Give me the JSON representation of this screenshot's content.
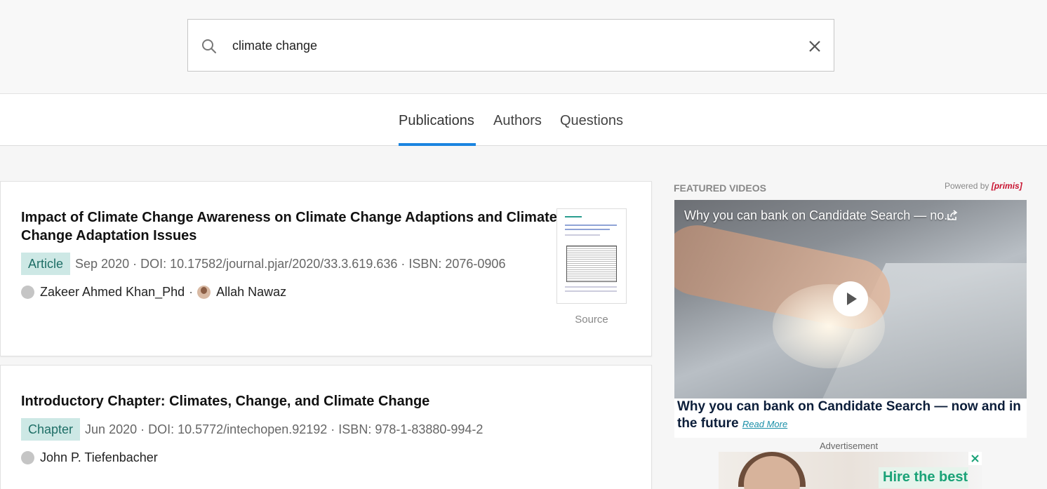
{
  "search": {
    "value": "climate change"
  },
  "tabs": [
    {
      "label": "Publications",
      "active": true
    },
    {
      "label": "Authors",
      "active": false
    },
    {
      "label": "Questions",
      "active": false
    }
  ],
  "results": [
    {
      "title_line1": "Impact of Climate Change Awareness on Climate Change Adaptions and Climate",
      "title_line2": "Change Adaptation Issues",
      "type": "Article",
      "meta": "Sep 2020 · DOI: 10.17582/journal.pjar/2020/33.3.619.636 · ISBN: 2076-0906",
      "authors": [
        "Zakeer Ahmed Khan_Phd",
        "Allah Nawaz"
      ],
      "source_label": "Source"
    },
    {
      "title_line1": "Introductory Chapter: Climates, Change, and Climate Change",
      "type": "Chapter",
      "meta": "Jun 2020 · DOI: 10.5772/intechopen.92192 · ISBN: 978-1-83880-994-2",
      "authors": [
        "John P. Tiefenbacher"
      ]
    }
  ],
  "sidebar": {
    "featured_label": "FEATURED VIDEOS",
    "powered_by": "Powered by",
    "brand": "[primis]",
    "video_title": "Why you can bank on Candidate Search — no...",
    "video_caption": "Why you can bank on Candidate Search — now and in the future",
    "read_more": "Read More",
    "ad_label": "Advertisement",
    "ad_text": "Hire the best"
  },
  "colors": {
    "accent": "#1a84e0",
    "badge_bg": "#cde8e5",
    "badge_text": "#1e6e66"
  }
}
